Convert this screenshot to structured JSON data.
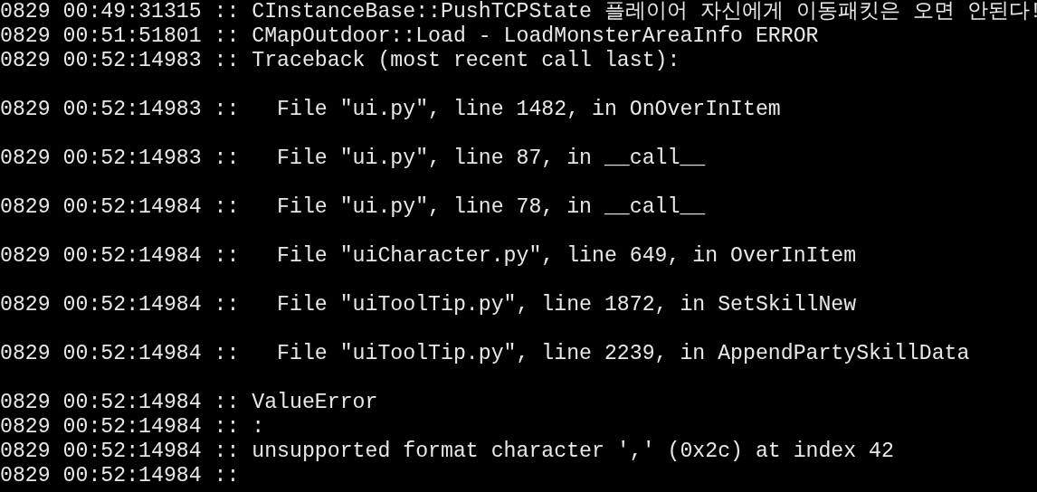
{
  "log_blocks": [
    [
      "0829 00:49:31315 :: CInstanceBase::PushTCPState 플레이어 자신에게 이동패킷은 오면 안된다!",
      "0829 00:51:51801 :: CMapOutdoor::Load - LoadMonsterAreaInfo ERROR",
      "0829 00:52:14983 :: Traceback (most recent call last):"
    ],
    [
      "0829 00:52:14983 ::   File \"ui.py\", line 1482, in OnOverInItem"
    ],
    [
      "0829 00:52:14983 ::   File \"ui.py\", line 87, in __call__"
    ],
    [
      "0829 00:52:14984 ::   File \"ui.py\", line 78, in __call__"
    ],
    [
      "0829 00:52:14984 ::   File \"uiCharacter.py\", line 649, in OverInItem"
    ],
    [
      "0829 00:52:14984 ::   File \"uiToolTip.py\", line 1872, in SetSkillNew"
    ],
    [
      "0829 00:52:14984 ::   File \"uiToolTip.py\", line 2239, in AppendPartySkillData"
    ],
    [
      "0829 00:52:14984 :: ValueError",
      "0829 00:52:14984 :: :",
      "0829 00:52:14984 :: unsupported format character ',' (0x2c) at index 42",
      "0829 00:52:14984 ::"
    ]
  ]
}
